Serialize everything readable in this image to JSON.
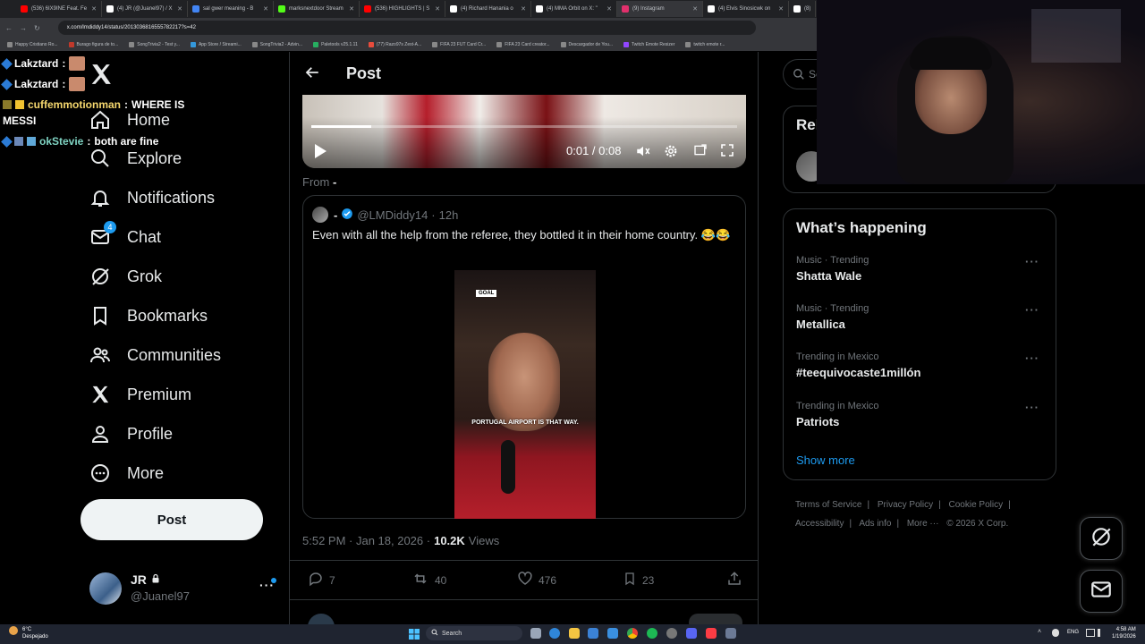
{
  "browser": {
    "tabs": [
      {
        "label": "(536) 6IX9INE Feat. Fe",
        "color": "#ff0000"
      },
      {
        "label": "(4) JR (@Juanel97) / X",
        "color": "#ffffff"
      },
      {
        "label": "sal gwer meaning - B",
        "color": "#4285f4"
      },
      {
        "label": "marksnextdoor Stream",
        "color": "#53fc18"
      },
      {
        "label": "(536) HIGHLIGHTS | S",
        "color": "#ff0000"
      },
      {
        "label": "(4) Richard Hanania o",
        "color": "#ffffff"
      },
      {
        "label": "(4) MMA Orbit on X: \"",
        "color": "#ffffff"
      },
      {
        "label": "(9) Instagram",
        "color": "#e1306c"
      },
      {
        "label": "(4) Elvis Sinosicwk on",
        "color": "#ffffff"
      },
      {
        "label": "(8)",
        "color": "#ffffff"
      }
    ],
    "url": "x.com/lmdiddy14/status/2013036816555782217?s=42",
    "bookmarks": [
      {
        "label": "Happy Cristiano Ro...",
        "color": "#888888"
      },
      {
        "label": "Burago figura de to...",
        "color": "#c0392b"
      },
      {
        "label": "SongTrivia2 - Test y...",
        "color": "#888888"
      },
      {
        "label": "App Store / Streami...",
        "color": "#3498db"
      },
      {
        "label": "SongTrivia2 - Advin...",
        "color": "#888888"
      },
      {
        "label": "Paletools v25.1.11",
        "color": "#27ae60"
      },
      {
        "label": "(77) Razo97s Zest-A...",
        "color": "#e74c3c"
      },
      {
        "label": "FIFA 23 FUT Card Cr...",
        "color": "#888888"
      },
      {
        "label": "FIFA 23 Card creator...",
        "color": "#888888"
      },
      {
        "label": "Descargador de You...",
        "color": "#888888"
      },
      {
        "label": "Twitch Emote Resizer",
        "color": "#9146ff"
      },
      {
        "label": "twitch emote r...",
        "color": "#888888"
      }
    ]
  },
  "chat": [
    {
      "user": "Lakztard",
      "sep": ":",
      "msg": "",
      "color": "#ffffff"
    },
    {
      "user": "Lakztard",
      "sep": ":",
      "msg": "",
      "color": "#ffffff"
    },
    {
      "user": "cuffemmotionman",
      "sep": ":",
      "msg": "WHERE IS",
      "color": "#f5d76e"
    },
    {
      "user": "",
      "sep": "",
      "msg": "MESSI",
      "color": "#ffffff"
    },
    {
      "user": "okStevie",
      "sep": ":",
      "msg": "both are fine",
      "color": "#7fd3c2"
    }
  ],
  "nav": {
    "items": [
      {
        "label": "Home",
        "icon": "home-icon"
      },
      {
        "label": "Explore",
        "icon": "search-icon"
      },
      {
        "label": "Notifications",
        "icon": "bell-icon"
      },
      {
        "label": "Chat",
        "icon": "mail-icon",
        "badge": "4"
      },
      {
        "label": "Grok",
        "icon": "grok-icon"
      },
      {
        "label": "Bookmarks",
        "icon": "bookmark-icon"
      },
      {
        "label": "Communities",
        "icon": "people-icon"
      },
      {
        "label": "Premium",
        "icon": "x-logo-icon"
      },
      {
        "label": "Profile",
        "icon": "person-icon"
      },
      {
        "label": "More",
        "icon": "more-circle-icon"
      }
    ],
    "post_button": "Post",
    "account": {
      "name": "JR",
      "handle": "@Juanel97"
    }
  },
  "post": {
    "header_title": "Post",
    "video": {
      "time": "0:01 / 0:08"
    },
    "from_label": "From",
    "from_name": "-",
    "quoted": {
      "display_name": "-",
      "handle": "@LMDiddy14",
      "sep": "·",
      "age": "12h",
      "text": "Even with all the help from the referee, they bottled it in their home country. 😂😂",
      "media_logo": "GOAL",
      "media_caption": "PORTUGAL AIRPORT IS THAT WAY."
    },
    "timestamp": "5:52 PM · Jan 18, 2026 ·",
    "views_count": "10.2K",
    "views_label": "Views",
    "actions": {
      "replies": "7",
      "reposts": "40",
      "likes": "476",
      "bookmarks": "23"
    }
  },
  "sidebar": {
    "search_placeholder": "Se",
    "relevant_title": "Rel",
    "happening_title": "What’s happening",
    "trends": [
      {
        "meta": "Music · Trending",
        "name": "Shatta Wale"
      },
      {
        "meta": "Music · Trending",
        "name": "Metallica"
      },
      {
        "meta": "Trending in Mexico",
        "name": "#teequivocaste1millón"
      },
      {
        "meta": "Trending in Mexico",
        "name": "Patriots"
      }
    ],
    "show_more": "Show more",
    "footer": [
      "Terms of Service",
      "|",
      "Privacy Policy",
      "|",
      "Cookie Policy",
      "|",
      "Accessibility",
      "|",
      "Ads info",
      "|",
      "More ···",
      "© 2026 X Corp."
    ]
  },
  "taskbar": {
    "weather_temp": "6°C",
    "weather_text": "Despejado",
    "search_label": "Search",
    "lang": "ENG",
    "time": "4:58 AM",
    "date": "1/19/2026"
  },
  "colors": {
    "accent": "#1d9bf0",
    "text": "#e7e9ea",
    "muted": "#71767b",
    "border": "#2f3336"
  }
}
